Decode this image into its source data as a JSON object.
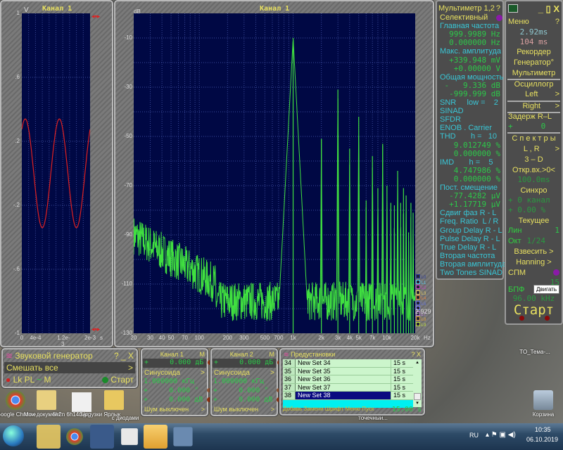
{
  "osc": {
    "title": "Канал 1",
    "unit": "V",
    "yticks": [
      "1",
      ".6",
      ".2",
      "-.2",
      "-.6",
      "-1"
    ],
    "xticks": [
      "0",
      "4e-4",
      "1.2e-3",
      "2e-3"
    ],
    "xunit": "s",
    "trace_color": "#e02020"
  },
  "spectrum": {
    "title": "Канал 1",
    "unit": "dB",
    "yticks": [
      "-10",
      "-30",
      "-50",
      "-70",
      "-90",
      "-110",
      "-130"
    ],
    "xticks": [
      "20",
      "30",
      "40",
      "50",
      "70",
      "100",
      "200",
      "300",
      "500",
      "700",
      "1k",
      "2k",
      "3k",
      "4k",
      "5k",
      "7k",
      "10k",
      "20k"
    ],
    "xunit": "Hz",
    "legend": [
      "L0",
      "L1",
      "L2",
      "L3",
      "L4",
      "L5",
      "",
      "L7",
      "L8",
      "L9"
    ],
    "legend_value": "2.929",
    "trace_color": "#40e040"
  },
  "chart_data": [
    {
      "type": "line",
      "title": "Канал 1",
      "ylabel": "V",
      "xlabel": "s",
      "xlim": [
        0,
        0.002
      ],
      "ylim": [
        -1,
        1
      ],
      "series": [
        {
          "frequency_hz": 1000,
          "amplitude_v": 0.34
        }
      ]
    },
    {
      "type": "line",
      "title": "Канал 1",
      "ylabel": "dB",
      "xlabel": "Hz",
      "xscale": "log",
      "xlim": [
        20,
        20000
      ],
      "ylim": [
        -130,
        0
      ],
      "grid": true,
      "peaks": {
        "x": [
          1000,
          2000,
          3000,
          4000,
          5000,
          6000,
          7000,
          8000,
          9000,
          10000,
          11000,
          12000,
          13000,
          14000,
          15000,
          16000,
          17000,
          18000,
          19000
        ],
        "y": [
          -10,
          -51,
          -31,
          -55,
          -42,
          -76,
          -58,
          -71,
          -53,
          -70,
          -77,
          -78,
          -64,
          -77,
          -71,
          -74,
          -89,
          -77,
          -81
        ]
      },
      "noise_floor_db": -115,
      "low_freq_level_db": -90
    }
  ],
  "multimeter": {
    "title": "Мультиметр 1,2",
    "help": "?",
    "lines": [
      {
        "t": "Селективный",
        "c": "y"
      },
      {
        "t": "Главная частота",
        "c": "c"
      },
      {
        "t": "999.9989 Hz",
        "c": "g r"
      },
      {
        "t": "0.000000 Hz",
        "c": "g r"
      },
      {
        "t": "Макс. амплитуда",
        "c": "c"
      },
      {
        "t": "+339.948 mV",
        "c": "g r"
      },
      {
        "t": "+0.00000 V",
        "c": "g r"
      },
      {
        "t": "Общая мощность",
        "c": "c"
      },
      {
        "t": "-   9.336 dB",
        "c": "g r"
      },
      {
        "t": "-999.999 dB",
        "c": "g r"
      },
      {
        "t": "SNR     low =    2",
        "c": "c"
      },
      {
        "t": "SINAD",
        "c": "c"
      },
      {
        "t": "SFDR",
        "c": "c"
      },
      {
        "t": "ENOB . Carrier",
        "c": "c"
      },
      {
        "t": "THD       h =   10",
        "c": "c"
      },
      {
        "t": "9.012749 %",
        "c": "g r"
      },
      {
        "t": "0.000000 %",
        "c": "g r"
      },
      {
        "t": "IMD       h =    5",
        "c": "c"
      },
      {
        "t": "4.747986 %",
        "c": "g r"
      },
      {
        "t": "0.000000 %",
        "c": "g r"
      },
      {
        "t": "Пост. смещение",
        "c": "c"
      },
      {
        "t": "-77.4282 µV",
        "c": "g r"
      },
      {
        "t": "+1.17719 µV",
        "c": "g r"
      },
      {
        "t": "Сдвиг фаз R - L",
        "c": "c"
      },
      {
        "t": "Freq. Ratio  L / R",
        "c": "c"
      },
      {
        "t": "Group Delay R - L",
        "c": "c"
      },
      {
        "t": "Pulse Delay R - L",
        "c": "c"
      },
      {
        "t": "True Delay R - L",
        "c": "c"
      },
      {
        "t": "Вторая частота",
        "c": "c"
      },
      {
        "t": "Вторая амплитуда",
        "c": "c"
      },
      {
        "t": "Two Tones SINAD",
        "c": "c"
      }
    ]
  },
  "control": {
    "win_buttons": "_ ▯ X",
    "menu": "Меню",
    "help": "?",
    "time1": "2.92ms",
    "time2": "104 ms",
    "recorder": "Рекордер",
    "generator": "Генератор°",
    "multimeter": "Мультиметр",
    "osc": "Осциллогр",
    "left": "Left",
    "right": "Right",
    "arrow": ">",
    "delay": "Задерж  R–L",
    "delay_sign": "+",
    "delay_val": "0",
    "spectra": "С п е к т р ы",
    "lr": "L , R",
    "td": "3 – D",
    "open_input": "Откр.вх.>0<",
    "open_val": "100.0ms",
    "sync": "Синхро",
    "sync1": "+  0 канал",
    "sync2": "+  0.00 %",
    "current": "Текущее",
    "lin": "Лин",
    "lin_val": "1",
    "okt": "Окт",
    "okt_val": "1/24",
    "weight": "Взвесить",
    "window": "Hanning",
    "spm": "СПМ",
    "n15": "15",
    "fft": "БПФ",
    "tooltip": "Двигать",
    "rate": "96.00 kHz",
    "start": "Старт"
  },
  "generator": {
    "title": "Звуковой генератор",
    "buttons": "?  _  X",
    "mix": "Смешать все",
    "arrow": ">",
    "modes": "Lk  PL",
    "wave": "~",
    "m": "M",
    "start": "Старт"
  },
  "channels": [
    {
      "title": "Канал 1",
      "m": "M",
      "level": "+     0.000 дБ",
      "wave": "Синусоида",
      "freq": "1.000000 кГц",
      "phase": "+     0.000 °",
      "amp": "+     0.000 дВ",
      "noise": "Шум выключен"
    },
    {
      "title": "Канал 2",
      "m": "M",
      "level": "+     0.000 дБ",
      "wave": "Синусоида",
      "freq": "1.000000 кГц",
      "phase": "+     0.000 °",
      "amp": "+     0.000 дВ",
      "noise": "Шум выключен"
    }
  ],
  "presets": {
    "title": "Предустановки",
    "buttons": "? X",
    "rows": [
      {
        "n": "34",
        "name": "New Set 34",
        "t": "15 s"
      },
      {
        "n": "35",
        "name": "New Set 35",
        "t": "15 s"
      },
      {
        "n": "36",
        "name": "New Set 36",
        "t": "15 s"
      },
      {
        "n": "37",
        "name": "New Set 37",
        "t": "15 s"
      },
      {
        "n": "38",
        "name": "New Set 38",
        "t": "15 s"
      }
    ],
    "footer": "Добавь Замени Шрифт Меню Пуск",
    "total": "15.00 s"
  },
  "desktop": {
    "icons": [
      "Google Chrome",
      "Мои документ...",
      "6h2n 6h14n.jpg",
      "Загрузки Ярлык",
      "с диодами",
      "точечный...",
      "TO_Тема-...",
      "Корзина"
    ]
  },
  "taskbar": {
    "lang": "RU",
    "time": "10:35",
    "date": "06.10.2019"
  }
}
